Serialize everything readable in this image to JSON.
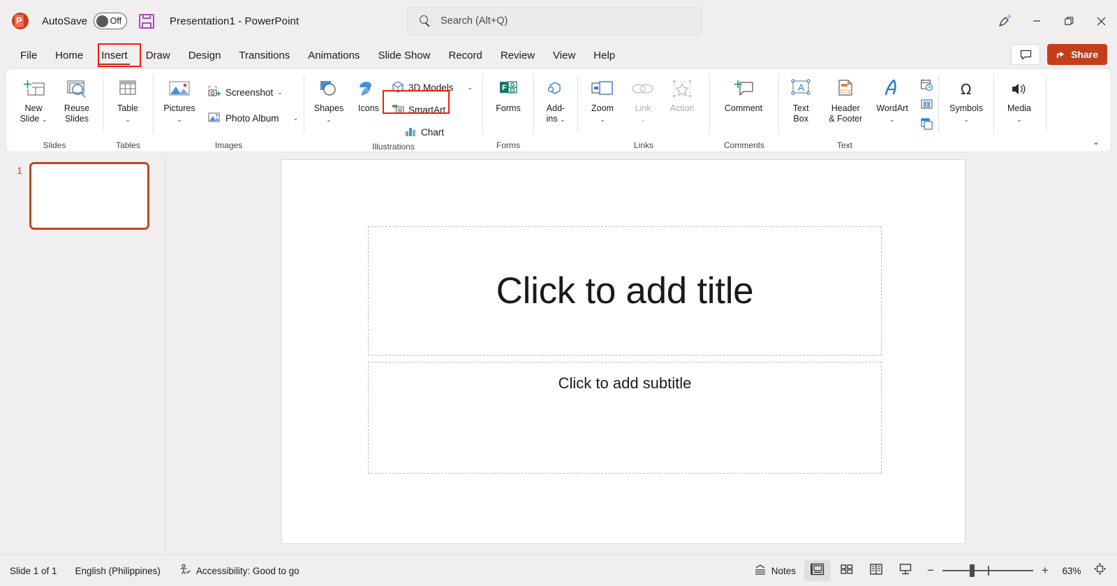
{
  "app": {
    "name": "PowerPoint",
    "document_title": "Presentation1",
    "title_separator": "-",
    "full_title": "Presentation1  -  PowerPoint",
    "autosave_label": "AutoSave",
    "autosave_state": "Off",
    "accent_color": "#c43e1c",
    "highlight_color": "#f41b0b"
  },
  "search": {
    "placeholder": "Search (Alt+Q)",
    "icon": "search-icon"
  },
  "window_controls": {
    "pen": "pen-icon",
    "minimize": "minimize-icon",
    "restore": "restore-icon",
    "close": "close-icon"
  },
  "header_actions": {
    "comment_label": "",
    "comment_icon": "comment-icon",
    "share_label": "Share",
    "share_icon": "share-icon"
  },
  "tabs": [
    {
      "label": "File",
      "active": false
    },
    {
      "label": "Home",
      "active": false
    },
    {
      "label": "Insert",
      "active": true
    },
    {
      "label": "Draw",
      "active": false
    },
    {
      "label": "Design",
      "active": false
    },
    {
      "label": "Transitions",
      "active": false
    },
    {
      "label": "Animations",
      "active": false
    },
    {
      "label": "Slide Show",
      "active": false
    },
    {
      "label": "Record",
      "active": false
    },
    {
      "label": "Review",
      "active": false
    },
    {
      "label": "View",
      "active": false
    },
    {
      "label": "Help",
      "active": false
    }
  ],
  "ribbon": {
    "collapse_icon": "chevron-down-icon",
    "groups": [
      {
        "name": "Slides",
        "label": "Slides",
        "items": [
          {
            "label": "New\nSlide",
            "label_l1": "New",
            "label_l2": "Slide",
            "icon": "new-slide-icon",
            "dropdown": true
          },
          {
            "label": "Reuse\nSlides",
            "label_l1": "Reuse",
            "label_l2": "Slides",
            "icon": "reuse-slides-icon",
            "dropdown": false
          }
        ]
      },
      {
        "name": "Tables",
        "label": "Tables",
        "items": [
          {
            "label": "Table",
            "icon": "table-icon",
            "dropdown": true
          }
        ]
      },
      {
        "name": "Images",
        "label": "Images",
        "items": [
          {
            "label": "Pictures",
            "icon": "pictures-icon",
            "dropdown": true
          },
          {
            "label": "Screenshot",
            "icon": "screenshot-icon",
            "dropdown": true
          },
          {
            "label": "Photo Album",
            "icon": "photo-album-icon",
            "dropdown": true
          }
        ]
      },
      {
        "name": "Illustrations",
        "label": "Illustrations",
        "items": [
          {
            "label": "Shapes",
            "icon": "shapes-icon",
            "dropdown": true
          },
          {
            "label": "Icons",
            "icon": "icons-icon",
            "dropdown": false
          },
          {
            "label": "3D Models",
            "icon": "3d-models-icon",
            "dropdown": true
          },
          {
            "label": "SmartArt",
            "icon": "smartart-icon",
            "dropdown": false,
            "highlighted": true
          },
          {
            "label": "Chart",
            "icon": "chart-icon",
            "dropdown": false
          }
        ]
      },
      {
        "name": "Forms",
        "label": "Forms",
        "items": [
          {
            "label": "Forms",
            "icon": "forms-icon",
            "dropdown": false
          }
        ]
      },
      {
        "name": "AddIns",
        "label": "",
        "items": [
          {
            "label_l1": "Add-",
            "label_l2": "ins",
            "icon": "add-ins-icon",
            "dropdown": true
          }
        ]
      },
      {
        "name": "Links",
        "label": "Links",
        "items": [
          {
            "label": "Zoom",
            "icon": "zoom-icon",
            "dropdown": true,
            "disabled": false
          },
          {
            "label": "Link",
            "icon": "link-icon",
            "dropdown": true,
            "disabled": true
          },
          {
            "label": "Action",
            "icon": "action-icon",
            "dropdown": false,
            "disabled": true
          }
        ]
      },
      {
        "name": "Comments",
        "label": "Comments",
        "items": [
          {
            "label": "Comment",
            "icon": "comment-icon",
            "dropdown": false
          }
        ]
      },
      {
        "name": "Text",
        "label": "Text",
        "items": [
          {
            "label_l1": "Text",
            "label_l2": "Box",
            "icon": "text-box-icon",
            "dropdown": false
          },
          {
            "label_l1": "Header",
            "label_l2": "& Footer",
            "icon": "header-footer-icon",
            "dropdown": false
          },
          {
            "label": "WordArt",
            "icon": "wordart-icon",
            "dropdown": true
          },
          {
            "label": "",
            "icon": "date-time-icon"
          },
          {
            "label": "",
            "icon": "slide-number-icon"
          },
          {
            "label": "",
            "icon": "object-icon"
          }
        ]
      },
      {
        "name": "Symbols",
        "label": "",
        "items": [
          {
            "label": "Symbols",
            "icon": "omega-icon",
            "dropdown": true
          }
        ]
      },
      {
        "name": "Media",
        "label": "",
        "items": [
          {
            "label": "Media",
            "icon": "media-icon",
            "dropdown": true
          }
        ]
      }
    ]
  },
  "thumbnails": {
    "slides": [
      {
        "number": "1",
        "selected": true
      }
    ]
  },
  "slide": {
    "title_placeholder": "Click to add title",
    "subtitle_placeholder": "Click to add subtitle"
  },
  "status_bar": {
    "slide_counter": "Slide 1 of 1",
    "language": "English (Philippines)",
    "accessibility": "Accessibility: Good to go",
    "accessibility_icon": "accessibility-icon",
    "notes_label": "Notes",
    "notes_icon": "notes-icon",
    "views": [
      {
        "name": "normal-view",
        "icon": "normal-view-icon",
        "active": true
      },
      {
        "name": "slide-sorter-view",
        "icon": "slide-sorter-icon",
        "active": false
      },
      {
        "name": "reading-view",
        "icon": "reading-view-icon",
        "active": false
      },
      {
        "name": "slide-show-view",
        "icon": "slide-show-icon",
        "active": false
      }
    ],
    "zoom_out": "−",
    "zoom_in": "+",
    "zoom_level": "63%",
    "fit_icon": "fit-to-window-icon"
  }
}
